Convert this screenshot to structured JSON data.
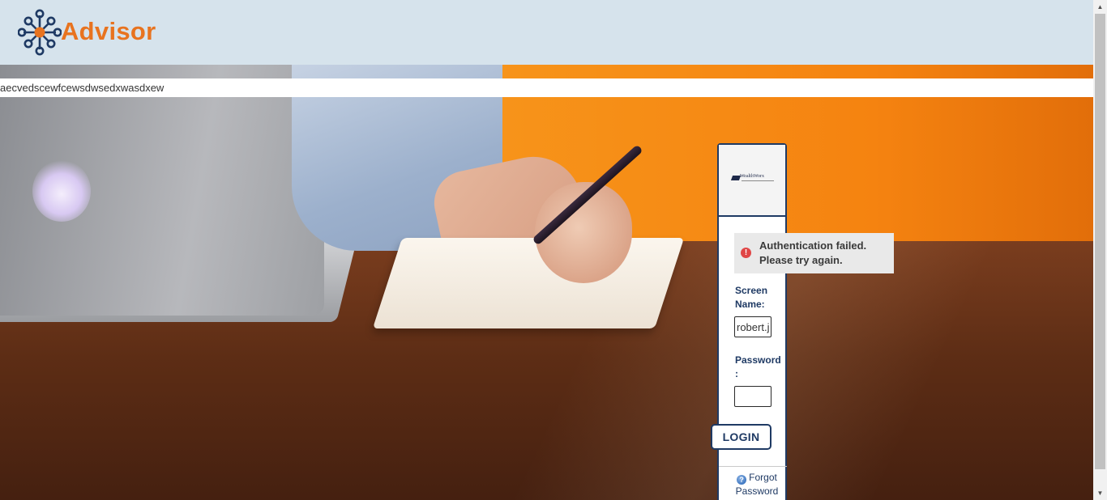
{
  "header": {
    "logo_text": "Advisor"
  },
  "banner": {
    "text": "aecvedscewfcewsdwsedxwasdxew"
  },
  "login": {
    "brand_logo_text": "WealthWorx",
    "alert": {
      "icon": "error-icon",
      "message": "Authentication failed. Please try again.",
      "color": "#e04646"
    },
    "screen_name_label": "Screen Name:",
    "screen_name_value": "robert.j",
    "password_label": "Password :",
    "password_value": "",
    "login_button": "LOGIN",
    "forgot_password": "Forgot Password",
    "forgot_icon": "help-icon"
  },
  "colors": {
    "header_bg": "#d6e3ec",
    "brand_orange": "#e8731f",
    "navy": "#1f3a64"
  }
}
